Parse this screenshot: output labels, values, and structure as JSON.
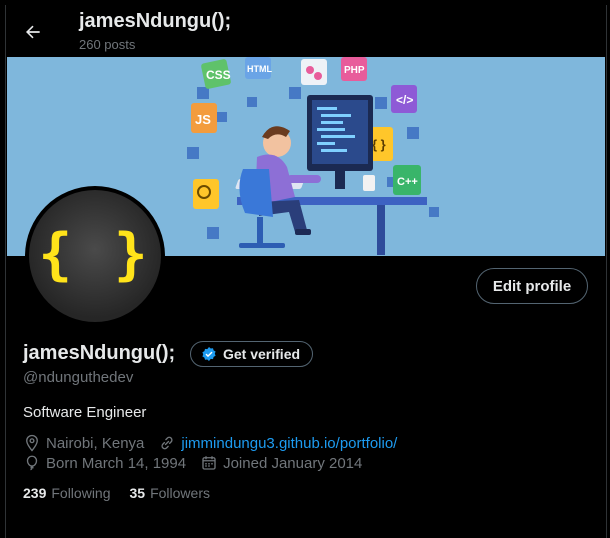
{
  "header": {
    "title": "jamesNdungu();",
    "posts_count": "260 posts"
  },
  "banner": {
    "labels": [
      "CSS",
      "HTML",
      "PHP",
      "JS",
      "C++"
    ]
  },
  "avatar": {
    "glyph": "{ }"
  },
  "actions": {
    "edit_profile": "Edit profile"
  },
  "profile": {
    "display_name": "jamesNdungu();",
    "verify_label": "Get verified",
    "handle": "@ndunguthedev",
    "bio": "Software Engineer",
    "location": "Nairobi, Kenya",
    "website": "jimmindungu3.github.io/portfolio/",
    "born": "Born March 14, 1994",
    "joined": "Joined January 2014"
  },
  "stats": {
    "following_count": "239",
    "following_label": "Following",
    "followers_count": "35",
    "followers_label": "Followers"
  },
  "colors": {
    "accent": "#1d9bf0",
    "avatar_braces": "#ffe31a",
    "banner_bg": "#7fb7dc"
  },
  "icons": [
    "back-arrow-icon",
    "verified-badge-icon",
    "location-icon",
    "link-icon",
    "balloon-icon",
    "calendar-icon"
  ]
}
